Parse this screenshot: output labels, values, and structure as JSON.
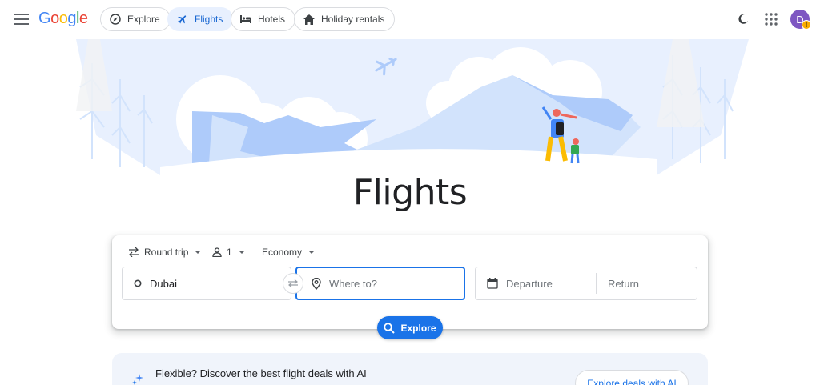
{
  "header": {
    "logo": {
      "letters": [
        "G",
        "o",
        "o",
        "g",
        "l",
        "e"
      ],
      "colors": [
        "#4285F4",
        "#EA4335",
        "#FBBC05",
        "#4285F4",
        "#34A853",
        "#EA4335"
      ]
    },
    "tabs": [
      {
        "label": "Explore",
        "icon": "explore-icon",
        "active": false
      },
      {
        "label": "Flights",
        "icon": "airplane-icon",
        "active": true
      },
      {
        "label": "Hotels",
        "icon": "bed-icon",
        "active": false
      },
      {
        "label": "Holiday rentals",
        "icon": "home-icon",
        "active": false
      }
    ],
    "avatar_initial": "D",
    "avatar_badge": "!"
  },
  "hero": {
    "title": "Flights"
  },
  "search": {
    "trip_type": "Round trip",
    "passengers": "1",
    "cabin_class": "Economy",
    "origin": "Dubai",
    "destination_placeholder": "Where to?",
    "departure_placeholder": "Departure",
    "return_placeholder": "Return",
    "explore_label": "Explore"
  },
  "ai_banner": {
    "text": "Flexible? Discover the best flight deals with AI",
    "button_label": "Explore deals with AI"
  },
  "colors": {
    "accent": "#1a73e8",
    "active_chip_bg": "#e8f0fe",
    "illustration_blue": "#aecbfa",
    "illustration_light": "#e8f0fe"
  }
}
